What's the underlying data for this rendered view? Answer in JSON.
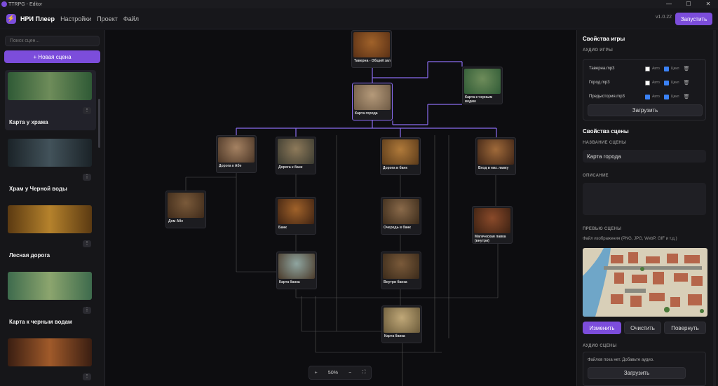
{
  "window": {
    "title": "TTRPG - Editor"
  },
  "header": {
    "brand": "НРИ Плеер",
    "menu": [
      "Настройки",
      "Проект",
      "Файл"
    ],
    "version": "v1.0.22",
    "run_label": "Запустить"
  },
  "sidebar": {
    "search_placeholder": "Поиск сцен...",
    "new_scene_label": "+ Новая сцена",
    "scenes": [
      {
        "name": "Карта у храма",
        "colors": [
          "#2f5a36",
          "#6e8c5a"
        ]
      },
      {
        "name": "Храм у Черной воды",
        "colors": [
          "#1b2328",
          "#42525a"
        ]
      },
      {
        "name": "Лесная дорога",
        "colors": [
          "#5b3a12",
          "#b5822c"
        ]
      },
      {
        "name": "Карта к черным водам",
        "colors": [
          "#3e6b4d",
          "#8ca56e"
        ]
      },
      {
        "name": "",
        "colors": [
          "#3a1e12",
          "#a05a2a"
        ]
      }
    ]
  },
  "canvas": {
    "nodes": [
      {
        "id": "tavern",
        "label": "Таверна - Общий зал",
        "c1": "#5a3015",
        "c2": "#a0622a"
      },
      {
        "id": "citymap",
        "label": "Карта города",
        "c1": "#6e5a45",
        "c2": "#b59a7a"
      },
      {
        "id": "map-black",
        "label": "Карта к черным водам",
        "c1": "#2f5a36",
        "c2": "#6e8c5a"
      },
      {
        "id": "road-abe",
        "label": "Дорога к Абе",
        "c1": "#4a3526",
        "c2": "#a58262"
      },
      {
        "id": "road-bank",
        "label": "Дорога к банк",
        "c1": "#3a3a30",
        "c2": "#8e7a5a"
      },
      {
        "id": "road-bank2",
        "label": "Дорога в банк",
        "c1": "#5a3a1a",
        "c2": "#b07a3a"
      },
      {
        "id": "enter-mage",
        "label": "Вход в маг. лавку",
        "c1": "#3e2416",
        "c2": "#a06a3a"
      },
      {
        "id": "abe-house",
        "label": "Дом Абе",
        "c1": "#3e2a1a",
        "c2": "#7a5a3a"
      },
      {
        "id": "bank",
        "label": "Банк",
        "c1": "#3e2212",
        "c2": "#a0622a"
      },
      {
        "id": "queue-bank",
        "label": "Очередь в банк",
        "c1": "#3a2a1a",
        "c2": "#8a6a4a"
      },
      {
        "id": "mage-shop",
        "label": "Магическая лавка (внутри)",
        "c1": "#3a2012",
        "c2": "#8a4a2a"
      },
      {
        "id": "bank-map",
        "label": "Карта банка",
        "c1": "#4a3a2a",
        "c2": "#8fa5a0"
      },
      {
        "id": "inside-bank",
        "label": "Внутри банка",
        "c1": "#3a2a1a",
        "c2": "#7a5a3a"
      },
      {
        "id": "bank-map2",
        "label": "Карта банка",
        "c1": "#6a5a3a",
        "c2": "#c0a878"
      }
    ],
    "zoom": "50%"
  },
  "right": {
    "game_props": "Свойства игры",
    "game_audio": "АУДИО ИГРЫ",
    "audio": [
      {
        "file": "Таверна.mp3",
        "auto": false,
        "loop": true
      },
      {
        "file": "Город.mp3",
        "auto": false,
        "loop": true
      },
      {
        "file": "Предыстория.mp3",
        "auto": true,
        "loop": true
      }
    ],
    "auto_label": "Авто",
    "loop_label": "Цикл",
    "upload": "Загрузить",
    "scene_props": "Свойства сцены",
    "scene_name_label": "НАЗВАНИЕ СЦЕНЫ",
    "scene_name": "Карта города",
    "desc_label": "ОПИСАНИЕ",
    "preview_label": "ПРЕВЬЮ СЦЕНЫ",
    "preview_hint": "Файл изображения (PNG, JPG, WebP, GIF и т.д.)",
    "change": "Изменить",
    "clear": "Очистить",
    "rotate": "Повернуть",
    "scene_audio_label": "АУДИО СЦЕНЫ",
    "no_files": "Файлов пока нет. Добавьте аудио.",
    "upload2": "Загрузить"
  }
}
